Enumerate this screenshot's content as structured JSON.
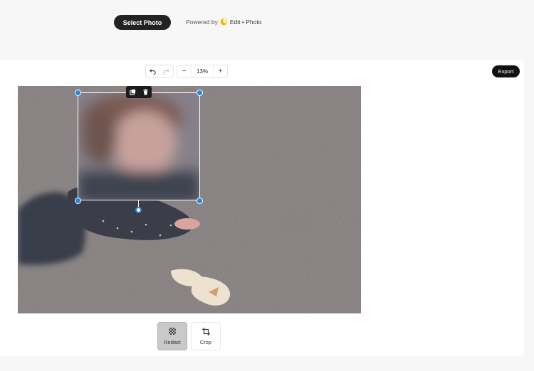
{
  "header": {
    "select_photo_label": "Select Photo",
    "powered_prefix": "Powered by",
    "powered_brand": "Edit • Photo",
    "brand_icon": "sun-moon-logo-icon",
    "brand_color": "#f5b400"
  },
  "toolbar": {
    "undo_icon": "undo-icon",
    "redo_icon": "redo-icon",
    "zoom_out_label": "−",
    "zoom_value": "13%",
    "zoom_in_label": "+"
  },
  "export_label": "Export",
  "selection": {
    "duplicate_icon": "duplicate-icon",
    "delete_icon": "trash-icon",
    "accent_color": "#1e88e5"
  },
  "tools": [
    {
      "label": "Redact",
      "icon": "checker-icon",
      "active": true
    },
    {
      "label": "Crop",
      "icon": "crop-icon",
      "active": false
    }
  ]
}
